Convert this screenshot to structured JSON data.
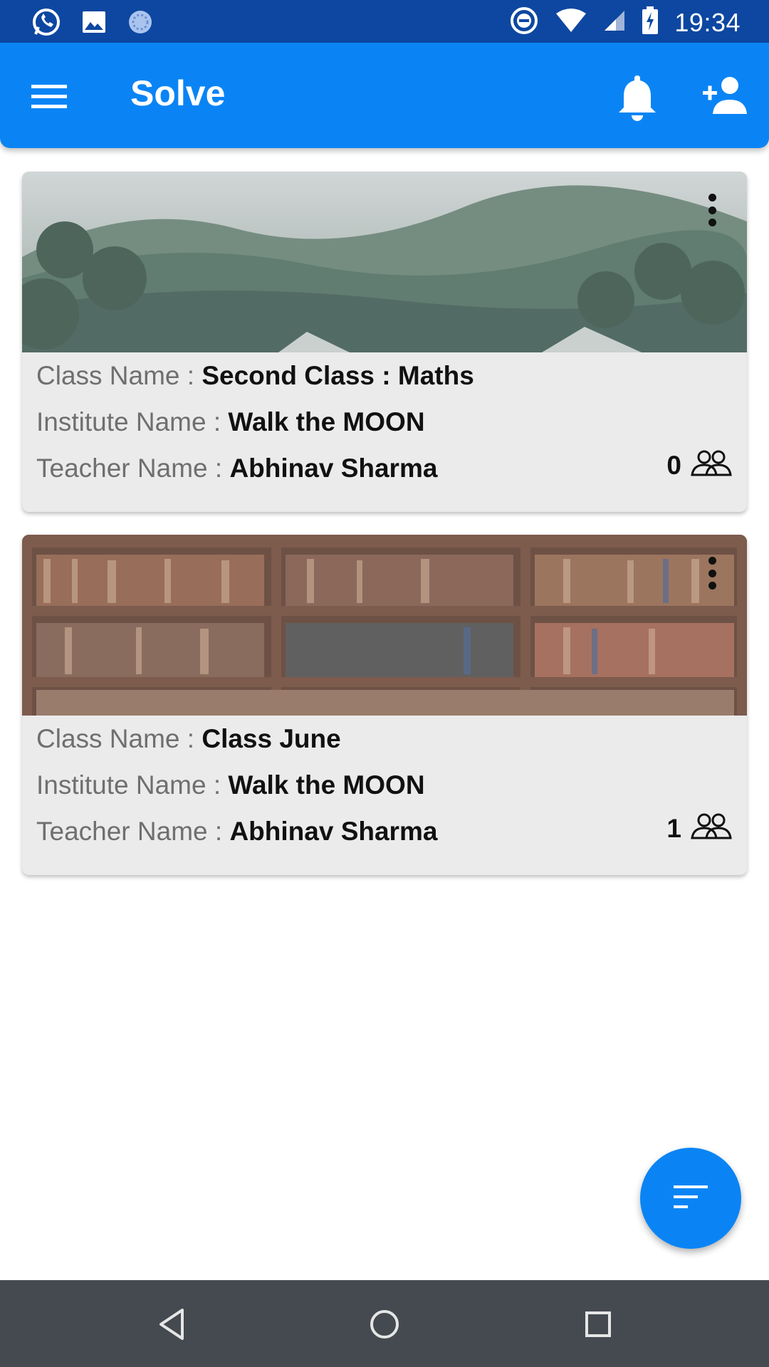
{
  "status_bar": {
    "time": "19:34",
    "left_icons": [
      "whatsapp-icon",
      "gallery-icon",
      "sync-icon"
    ],
    "right_icons": [
      "dnd-icon",
      "wifi-icon",
      "signal-icon",
      "battery-icon"
    ]
  },
  "app_bar": {
    "title": "Solve",
    "menu_icon": "hamburger-menu-icon",
    "notification_icon": "bell-icon",
    "add_user_icon": "add-user-icon",
    "color": "#0a84f5"
  },
  "classes": [
    {
      "class_label": "Class Name : ",
      "class_name": "Second Class : Maths",
      "institute_label": "Institute Name : ",
      "institute_name": "Walk the MOON",
      "teacher_label": "Teacher Name : ",
      "teacher_name": "Abhinav Sharma",
      "member_count": "0",
      "image": "forest-hills"
    },
    {
      "class_label": "Class Name : ",
      "class_name": "Class June",
      "institute_label": "Institute Name : ",
      "institute_name": "Walk the MOON",
      "teacher_label": "Teacher Name : ",
      "teacher_name": "Abhinav Sharma",
      "member_count": "1",
      "image": "bookshelf"
    }
  ],
  "fab": {
    "icon": "sort-icon"
  },
  "nav_bar": {
    "buttons": [
      "back-icon",
      "home-icon",
      "recent-apps-icon"
    ]
  }
}
